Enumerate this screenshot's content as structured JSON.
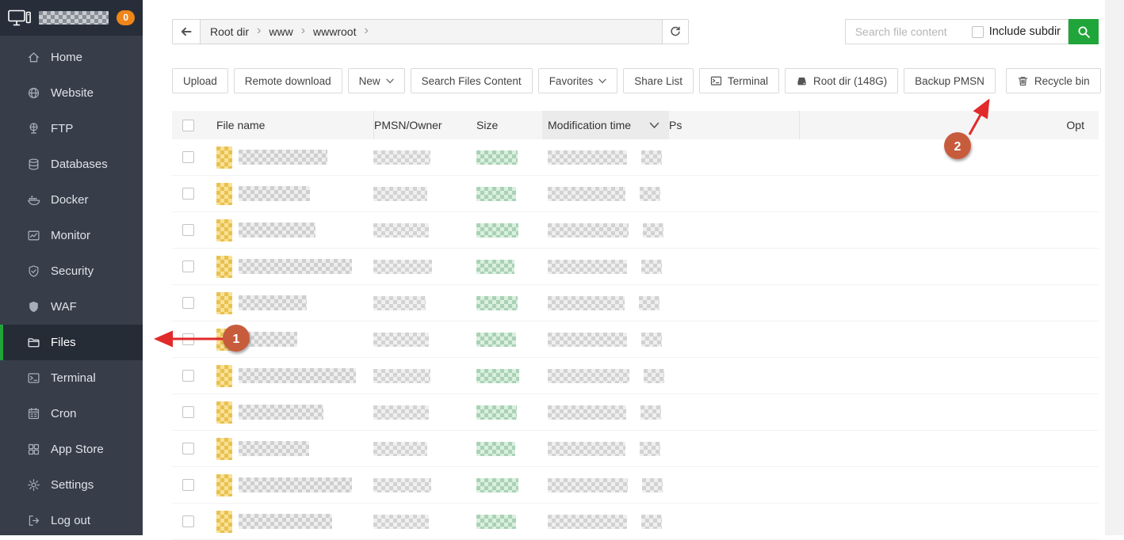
{
  "header": {
    "badge": "0"
  },
  "sidebar": {
    "items": [
      {
        "label": "Home",
        "icon": "home"
      },
      {
        "label": "Website",
        "icon": "website"
      },
      {
        "label": "FTP",
        "icon": "ftp"
      },
      {
        "label": "Databases",
        "icon": "databases"
      },
      {
        "label": "Docker",
        "icon": "docker"
      },
      {
        "label": "Monitor",
        "icon": "monitor"
      },
      {
        "label": "Security",
        "icon": "security"
      },
      {
        "label": "WAF",
        "icon": "waf"
      },
      {
        "label": "Files",
        "icon": "files",
        "active": true
      },
      {
        "label": "Terminal",
        "icon": "terminal"
      },
      {
        "label": "Cron",
        "icon": "cron"
      },
      {
        "label": "App Store",
        "icon": "appstore"
      },
      {
        "label": "Settings",
        "icon": "settings"
      },
      {
        "label": "Log out",
        "icon": "logout"
      }
    ]
  },
  "breadcrumb": {
    "segments": [
      "Root dir",
      "www",
      "wwwroot"
    ]
  },
  "search": {
    "placeholder": "Search file content",
    "include_subdir": "Include subdir"
  },
  "toolbar": {
    "left": [
      {
        "label": "Upload"
      },
      {
        "label": "Remote download"
      },
      {
        "label": "New",
        "caret": true
      },
      {
        "label": "Search Files Content"
      },
      {
        "label": "Favorites",
        "caret": true
      },
      {
        "label": "Share List"
      },
      {
        "label": "Terminal",
        "icon": "terminal-sm"
      },
      {
        "label": "Root dir (148G)",
        "icon": "disk"
      }
    ],
    "right": [
      {
        "label": "Backup PMSN"
      },
      {
        "label": "Recycle bin",
        "icon": "trash"
      }
    ],
    "view_toggles": [
      {
        "icon": "grid-view",
        "active": false
      },
      {
        "icon": "list-view",
        "active": true
      }
    ]
  },
  "table": {
    "columns": [
      "File name",
      "PMSN/Owner",
      "Size",
      "Modification time",
      "Ps",
      "Opt"
    ],
    "sorted_column": "Modification time",
    "rows": [
      {
        "name_w": 112,
        "owner_w": 72,
        "size_w": 52,
        "time_w": 100,
        "time2_w": 26
      },
      {
        "name_w": 90,
        "owner_w": 68,
        "size_w": 50,
        "time_w": 98,
        "time2_w": 26
      },
      {
        "name_w": 97,
        "owner_w": 70,
        "size_w": 53,
        "time_w": 102,
        "time2_w": 26
      },
      {
        "name_w": 143,
        "owner_w": 74,
        "size_w": 48,
        "time_w": 100,
        "time2_w": 26
      },
      {
        "name_w": 86,
        "owner_w": 66,
        "size_w": 52,
        "time_w": 97,
        "time2_w": 26
      },
      {
        "name_w": 74,
        "owner_w": 70,
        "size_w": 50,
        "time_w": 100,
        "time2_w": 26
      },
      {
        "name_w": 148,
        "owner_w": 72,
        "size_w": 54,
        "time_w": 103,
        "time2_w": 26
      },
      {
        "name_w": 107,
        "owner_w": 70,
        "size_w": 51,
        "time_w": 99,
        "time2_w": 26
      },
      {
        "name_w": 89,
        "owner_w": 68,
        "size_w": 49,
        "time_w": 98,
        "time2_w": 26
      },
      {
        "name_w": 143,
        "owner_w": 73,
        "size_w": 53,
        "time_w": 101,
        "time2_w": 26
      },
      {
        "name_w": 118,
        "owner_w": 70,
        "size_w": 50,
        "time_w": 100,
        "time2_w": 26
      }
    ]
  },
  "annotations": [
    {
      "label": "1",
      "target": "sidebar-item-files"
    },
    {
      "label": "2",
      "target": "recycle-bin-button"
    }
  ],
  "colors": {
    "accent_green": "#20a53a",
    "badge_orange": "#f08519",
    "annotation_circle": "#c75b3c",
    "arrow_red": "#e12a2a",
    "sidebar_bg": "#373e4a",
    "sidebar_active_bg": "#262c36"
  }
}
